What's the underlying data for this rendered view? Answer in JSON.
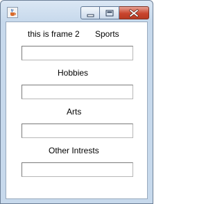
{
  "window": {
    "icon": "java-cup-icon",
    "buttons": [
      "minimize-icon",
      "maximize-icon",
      "close-icon"
    ]
  },
  "form": {
    "frame_label": "this is frame 2",
    "sports_label": "Sports",
    "sports_value": "",
    "hobbies_label": "Hobbies",
    "hobbies_value": "",
    "arts_label": "Arts",
    "arts_value": "",
    "other_label": "Other Intrests",
    "other_value": ""
  }
}
